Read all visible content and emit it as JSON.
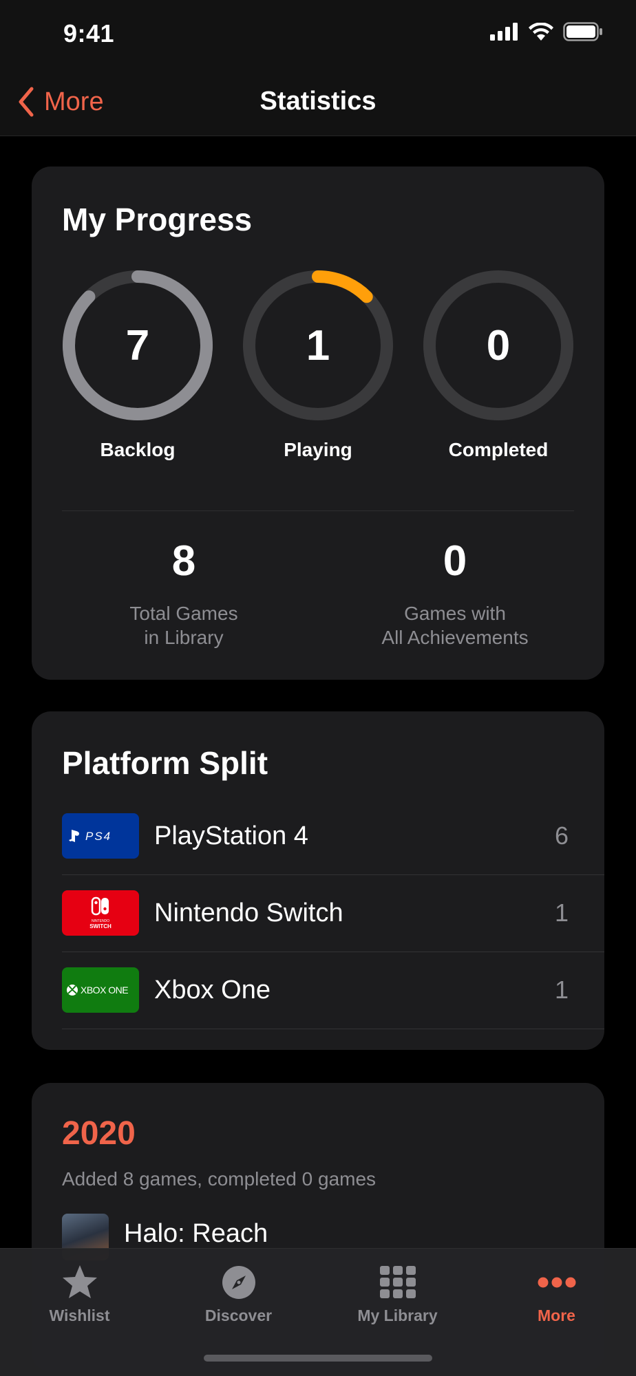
{
  "status_bar": {
    "time": "9:41"
  },
  "nav": {
    "back_label": "More",
    "title": "Statistics"
  },
  "progress": {
    "title": "My Progress",
    "rings": [
      {
        "label": "Backlog",
        "value": "7",
        "fraction": 0.875,
        "color": "#8e8e93"
      },
      {
        "label": "Playing",
        "value": "1",
        "fraction": 0.125,
        "color": "#ff9f0a"
      },
      {
        "label": "Completed",
        "value": "0",
        "fraction": 0.0,
        "color": "#8e8e93"
      }
    ],
    "total_games": {
      "value": "8",
      "label_line1": "Total Games",
      "label_line2": "in Library"
    },
    "all_achievements": {
      "value": "0",
      "label_line1": "Games with",
      "label_line2": "All Achievements"
    }
  },
  "platforms": {
    "title": "Platform Split",
    "items": [
      {
        "name": "PlayStation 4",
        "count": "6",
        "logo_text": "PS4",
        "color": "#00359b"
      },
      {
        "name": "Nintendo Switch",
        "count": "1",
        "logo_text": "NINTENDO SWITCH",
        "color": "#e60012"
      },
      {
        "name": "Xbox One",
        "count": "1",
        "logo_text": "XBOX ONE",
        "color": "#107c10"
      }
    ]
  },
  "year": {
    "title": "2020",
    "subtitle": "Added 8 games, completed 0 games",
    "games": [
      {
        "name": "Halo: Reach"
      }
    ]
  },
  "tabs": [
    {
      "label": "Wishlist",
      "icon": "star-icon"
    },
    {
      "label": "Discover",
      "icon": "compass-icon"
    },
    {
      "label": "My Library",
      "icon": "grid-icon"
    },
    {
      "label": "More",
      "icon": "more-icon",
      "active": true
    }
  ],
  "colors": {
    "accent": "#f0644a",
    "playing": "#ff9f0a",
    "card": "#1c1c1e"
  }
}
